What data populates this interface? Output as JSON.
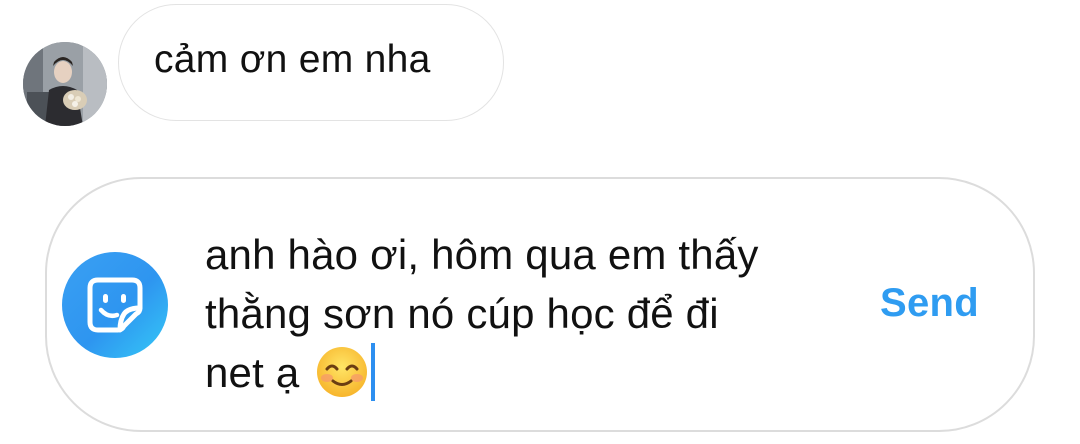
{
  "thread": {
    "incoming_message": {
      "text": "cảm ơn em nha",
      "avatar": "user-avatar"
    }
  },
  "composer": {
    "draft_lines": [
      "anh hào ơi, hôm qua em thấy",
      "thằng sơn nó cúp học để đi",
      "net ạ"
    ],
    "emoji": "smiling-face-with-smiling-eyes",
    "send_label": "Send",
    "sticker_icon": "sticker-icon"
  },
  "colors": {
    "accent": "#2f9cf1",
    "caret": "#2d8ff0",
    "bubble_border": "#e3e3e3",
    "composer_border": "#dcdcdc",
    "text": "#111111"
  }
}
